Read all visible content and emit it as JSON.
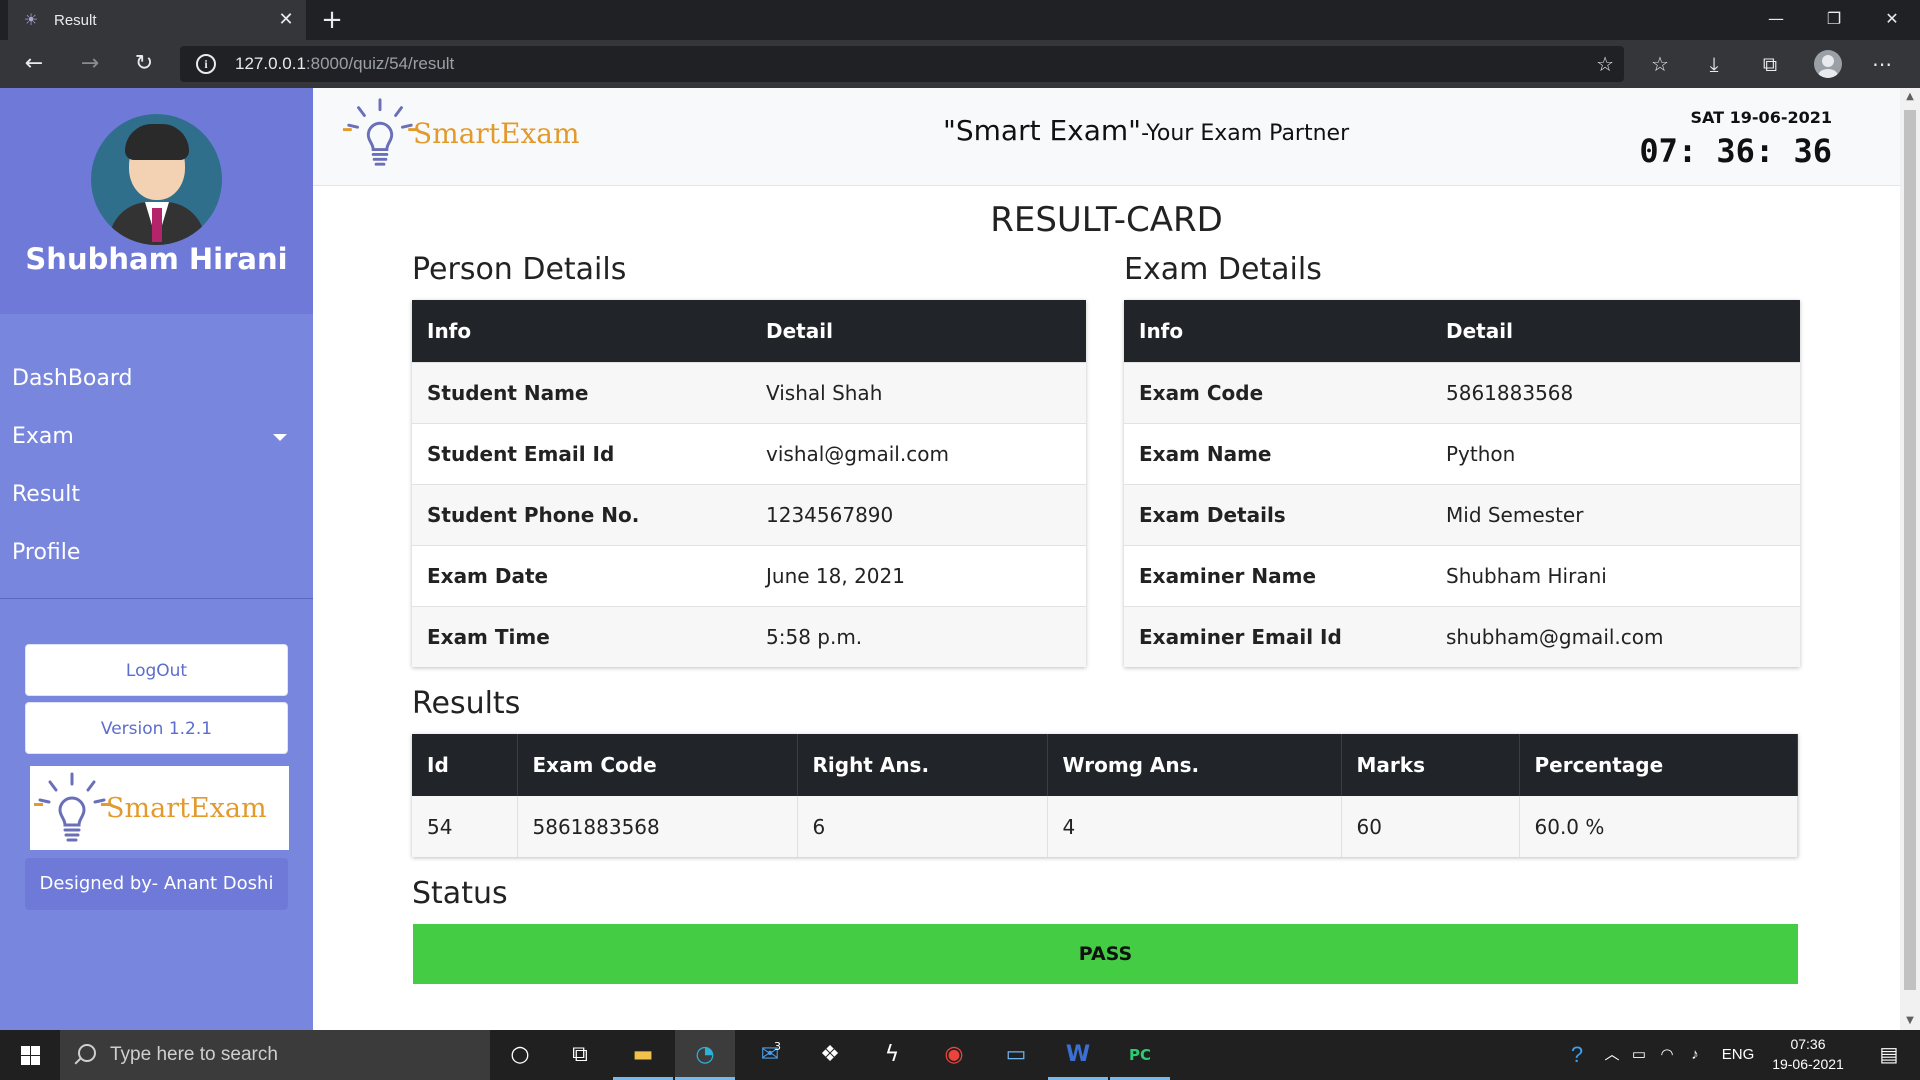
{
  "browser": {
    "tab_title": "Result",
    "url_host": "127.0.0.1",
    "url_path": ":8000/quiz/54/result"
  },
  "sidebar": {
    "user_name": "Shubham Hirani",
    "items": [
      {
        "label": "DashBoard"
      },
      {
        "label": "Exam"
      },
      {
        "label": "Result"
      },
      {
        "label": "Profile"
      }
    ],
    "logout_label": "LogOut",
    "version_label": "Version 1.2.1",
    "designer_label": "Designed by- Anant Doshi"
  },
  "brand": {
    "logo_text": "SmartExam"
  },
  "header": {
    "tagline_main": "\"Smart Exam\"",
    "tagline_sub": "-Your Exam Partner",
    "date": "SAT 19-06-2021",
    "time": "07: 36: 36"
  },
  "page_title": "RESULT-CARD",
  "person": {
    "heading": "Person Details",
    "col_info": "Info",
    "col_detail": "Detail",
    "rows": [
      {
        "k": "Student Name",
        "v": "Vishal Shah"
      },
      {
        "k": "Student Email Id",
        "v": "vishal@gmail.com"
      },
      {
        "k": "Student Phone No.",
        "v": "1234567890"
      },
      {
        "k": "Exam Date",
        "v": "June 18, 2021"
      },
      {
        "k": "Exam Time",
        "v": "5:58 p.m."
      }
    ]
  },
  "exam": {
    "heading": "Exam Details",
    "col_info": "Info",
    "col_detail": "Detail",
    "rows": [
      {
        "k": "Exam Code",
        "v": "5861883568"
      },
      {
        "k": "Exam Name",
        "v": "Python"
      },
      {
        "k": "Exam Details",
        "v": "Mid Semester"
      },
      {
        "k": "Examiner Name",
        "v": "Shubham Hirani"
      },
      {
        "k": "Examiner Email Id",
        "v": "shubham@gmail.com"
      }
    ]
  },
  "results": {
    "heading": "Results",
    "columns": [
      "Id",
      "Exam Code",
      "Right Ans.",
      "Wromg Ans.",
      "Marks",
      "Percentage"
    ],
    "row": [
      "54",
      "5861883568",
      "6",
      "4",
      "60",
      "60.0 %"
    ]
  },
  "status": {
    "heading": "Status",
    "value": "PASS",
    "color": "#44cc44"
  },
  "taskbar": {
    "search_placeholder": "Type here to search",
    "mail_badge": "3",
    "language": "ENG",
    "time": "07:36",
    "date": "19-06-2021"
  },
  "colors": {
    "sidebar": "#7986de",
    "table_header": "#212529",
    "brand_orange": "#e29a2c"
  }
}
